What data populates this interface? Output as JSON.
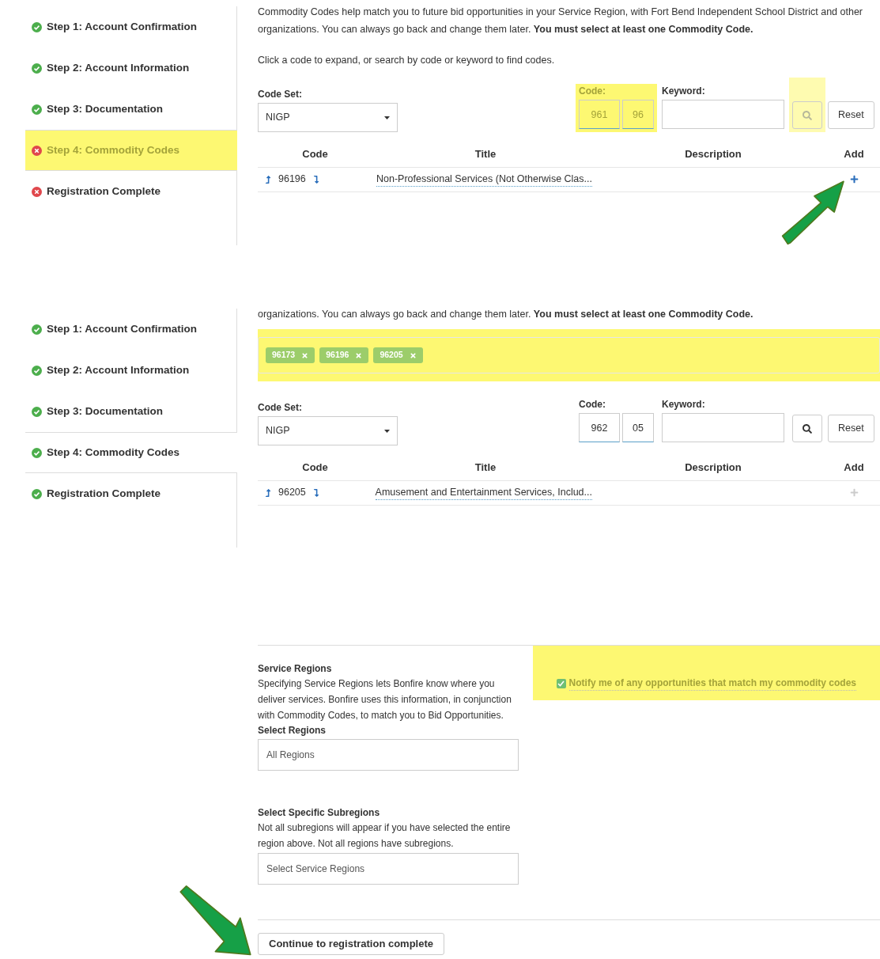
{
  "panels": [
    {
      "steps": [
        {
          "label": "Step 1: Account Confirmation",
          "complete": true,
          "active": false,
          "highlighted": false
        },
        {
          "label": "Step 2: Account Information",
          "complete": true,
          "active": false,
          "highlighted": false
        },
        {
          "label": "Step 3: Documentation",
          "complete": true,
          "active": false,
          "highlighted": false
        },
        {
          "label": "Step 4: Commodity Codes",
          "complete": false,
          "active": true,
          "highlighted": true
        },
        {
          "label": "Registration Complete",
          "complete": false,
          "active": false,
          "highlighted": false
        }
      ],
      "intro": "Commodity Codes help match you to future bid opportunities in your Service Region, with Fort Bend Independent School District and other organizations. You can always go back and change them later. **You must select at least one Commodity Code.**",
      "hint": "Click a code to expand, or search by code or keyword to find codes.",
      "code_set": {
        "label": "Code Set:",
        "value": "NIGP"
      },
      "code": {
        "label": "Code:",
        "part_1": "961",
        "part_2": "96",
        "highlighted": true
      },
      "keyword": {
        "label": "Keyword:"
      },
      "search": {
        "highlighted": true
      },
      "reset": "Reset",
      "columns": [
        "Code",
        "Title",
        "Description",
        "Add"
      ],
      "rows": [
        {
          "code": "96196",
          "title": "Non-Professional Services (Not Otherwise Clas...",
          "disabled": false
        }
      ],
      "arrow": true
    },
    {
      "steps": [
        {
          "label": "Step 1: Account Confirmation",
          "complete": true,
          "active": false,
          "highlighted": false
        },
        {
          "label": "Step 2: Account Information",
          "complete": true,
          "active": false,
          "highlighted": false
        },
        {
          "label": "Step 3: Documentation",
          "complete": true,
          "active": false,
          "highlighted": false
        },
        {
          "label": "Step 4: Commodity Codes",
          "complete": true,
          "active": true,
          "highlighted": false
        },
        {
          "label": "Registration Complete",
          "complete": true,
          "active": false,
          "highlighted": false
        }
      ],
      "intro": "organizations. You can always go back and change them later. **You must select at least one Commodity Code.**",
      "tags": {
        "highlighted": true,
        "items": [
          {
            "label": "96173"
          },
          {
            "label": "96196"
          },
          {
            "label": "96205"
          }
        ]
      },
      "code_set": {
        "label": "Code Set:",
        "value": "NIGP"
      },
      "code": {
        "label": "Code:",
        "part_1": "962",
        "part_2": "05",
        "highlighted": false
      },
      "keyword": {
        "label": "Keyword:"
      },
      "search": {
        "highlighted": false
      },
      "reset": "Reset",
      "columns": [
        "Code",
        "Title",
        "Description",
        "Add"
      ],
      "rows": [
        {
          "code": "96205",
          "title": "Amusement and Entertainment Services, Includ...",
          "disabled": true
        }
      ],
      "arrow": false
    }
  ],
  "regions": {
    "title": "Service Regions",
    "text": "Specifying Service Regions lets Bonfire know where you deliver services. Bonfire uses this information, in conjunction with Commodity Codes, to match you to Bid Opportunities.",
    "select_label": "Select Regions",
    "select_placeholder": "All Regions"
  },
  "subregions": {
    "title": "Select Specific Subregions",
    "text": "Not all subregions will appear if you have selected the entire region above. Not all regions have subregions.",
    "placeholder": "Select Service Regions"
  },
  "notify": {
    "label": "Notify me of any opportunities that match my commodity codes",
    "checked": true,
    "highlighted": true
  },
  "continue": {
    "label": "Continue to registration complete",
    "arrow": true
  }
}
